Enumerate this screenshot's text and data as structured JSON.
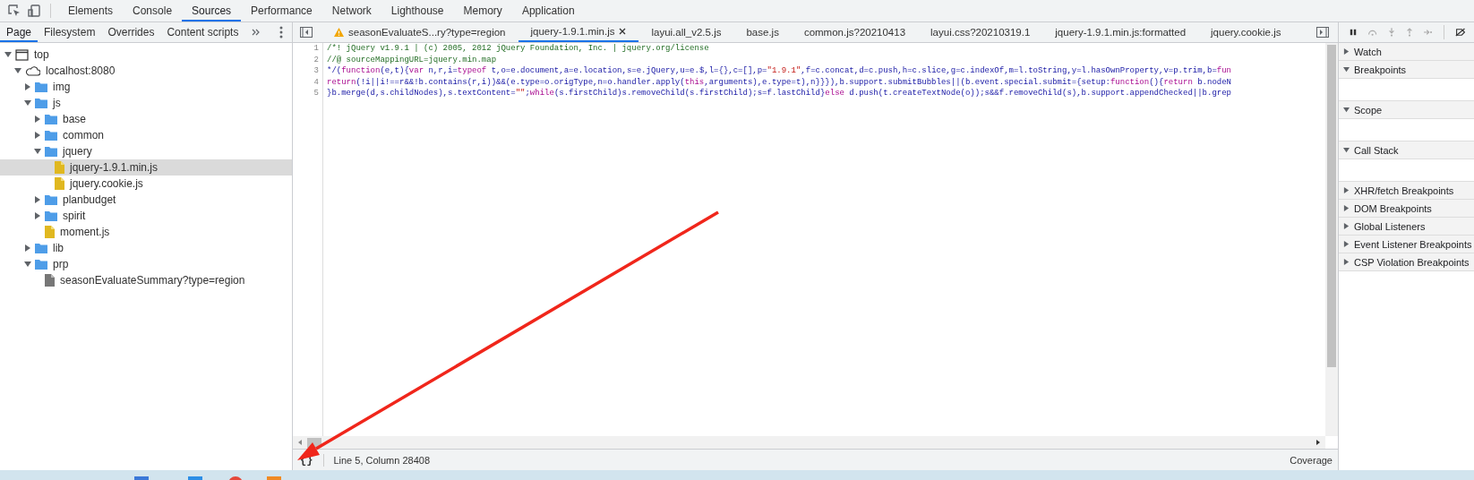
{
  "main_tabs": [
    {
      "label": "Elements",
      "selected": false
    },
    {
      "label": "Console",
      "selected": false
    },
    {
      "label": "Sources",
      "selected": true
    },
    {
      "label": "Performance",
      "selected": false
    },
    {
      "label": "Network",
      "selected": false
    },
    {
      "label": "Lighthouse",
      "selected": false
    },
    {
      "label": "Memory",
      "selected": false
    },
    {
      "label": "Application",
      "selected": false
    }
  ],
  "navigator_tabs": [
    {
      "label": "Page",
      "selected": true
    },
    {
      "label": "Filesystem",
      "selected": false
    },
    {
      "label": "Overrides",
      "selected": false
    },
    {
      "label": "Content scripts",
      "selected": false
    }
  ],
  "file_tree": [
    {
      "label": "top",
      "kind": "frame",
      "expanded": true,
      "selected": false,
      "children": [
        {
          "label": "localhost:8080",
          "kind": "domain",
          "expanded": true,
          "selected": false,
          "children": [
            {
              "label": "img",
              "kind": "folder",
              "expanded": false,
              "selected": false
            },
            {
              "label": "js",
              "kind": "folder",
              "expanded": true,
              "selected": false,
              "children": [
                {
                  "label": "base",
                  "kind": "folder",
                  "expanded": false,
                  "selected": false
                },
                {
                  "label": "common",
                  "kind": "folder",
                  "expanded": false,
                  "selected": false
                },
                {
                  "label": "jquery",
                  "kind": "folder",
                  "expanded": true,
                  "selected": false,
                  "children": [
                    {
                      "label": "jquery-1.9.1.min.js",
                      "kind": "script",
                      "selected": true
                    },
                    {
                      "label": "jquery.cookie.js",
                      "kind": "script",
                      "selected": false
                    }
                  ]
                },
                {
                  "label": "planbudget",
                  "kind": "folder",
                  "expanded": false,
                  "selected": false
                },
                {
                  "label": "spirit",
                  "kind": "folder",
                  "expanded": false,
                  "selected": false
                },
                {
                  "label": "moment.js",
                  "kind": "script",
                  "selected": false
                }
              ]
            },
            {
              "label": "lib",
              "kind": "folder",
              "expanded": false,
              "selected": false
            },
            {
              "label": "prp",
              "kind": "folder",
              "expanded": true,
              "selected": false,
              "children": [
                {
                  "label": "seasonEvaluateSummary?type=region",
                  "kind": "document",
                  "selected": false
                }
              ]
            }
          ]
        }
      ]
    }
  ],
  "editor_tabs": [
    {
      "label": "seasonEvaluateS...ry?type=region",
      "warning": true,
      "selected": false
    },
    {
      "label": "jquery-1.9.1.min.js",
      "warning": false,
      "selected": true
    },
    {
      "label": "layui.all_v2.5.js",
      "warning": false,
      "selected": false
    },
    {
      "label": "base.js",
      "warning": false,
      "selected": false
    },
    {
      "label": "common.js?20210413",
      "warning": false,
      "selected": false
    },
    {
      "label": "layui.css?20210319.1",
      "warning": false,
      "selected": false
    },
    {
      "label": "jquery-1.9.1.min.js:formatted",
      "warning": false,
      "selected": false
    },
    {
      "label": "jquery.cookie.js",
      "warning": false,
      "selected": false
    }
  ],
  "code_lines": [
    {
      "number": "1",
      "segments": [
        {
          "kind": "comment",
          "text": "/*! jQuery v1.9.1 | (c) 2005, 2012 jQuery Foundation, Inc. | jquery.org/license"
        }
      ]
    },
    {
      "number": "2",
      "segments": [
        {
          "kind": "comment",
          "text": "//@ sourceMappingURL=jquery.min.map"
        }
      ]
    },
    {
      "number": "3",
      "segments": [
        {
          "kind": "plain",
          "text": "*/("
        },
        {
          "kind": "keyword",
          "text": "function"
        },
        {
          "kind": "plain",
          "text": "(e,t){"
        },
        {
          "kind": "keyword",
          "text": "var"
        },
        {
          "kind": "plain",
          "text": " n,r,i="
        },
        {
          "kind": "keyword",
          "text": "typeof"
        },
        {
          "kind": "plain",
          "text": " t,o=e.document,a=e.location,s=e.jQuery,u=e.$,l={},c=[],p="
        },
        {
          "kind": "string",
          "text": "\"1.9.1\""
        },
        {
          "kind": "plain",
          "text": ",f=c.concat,d=c.push,h=c.slice,g=c.indexOf,m=l.toString,y=l.hasOwnProperty,v=p.trim,b="
        },
        {
          "kind": "keyword",
          "text": "fun"
        }
      ]
    },
    {
      "number": "4",
      "segments": [
        {
          "kind": "keyword",
          "text": "return"
        },
        {
          "kind": "plain",
          "text": "(!i||i!==r&&!b.contains(r,i))&&(e.type=o.origType,n=o.handler.apply("
        },
        {
          "kind": "keyword",
          "text": "this"
        },
        {
          "kind": "plain",
          "text": ",arguments),e.type=t),n}}}),b.support.submitBubbles||(b.event.special.submit={setup:"
        },
        {
          "kind": "keyword",
          "text": "function"
        },
        {
          "kind": "plain",
          "text": "(){"
        },
        {
          "kind": "keyword",
          "text": "return"
        },
        {
          "kind": "plain",
          "text": " b.nodeN"
        }
      ]
    },
    {
      "number": "5",
      "segments": [
        {
          "kind": "plain",
          "text": "}b.merge(d,s.childNodes),s.textContent="
        },
        {
          "kind": "string",
          "text": "\"\""
        },
        {
          "kind": "plain",
          "text": ";"
        },
        {
          "kind": "keyword",
          "text": "while"
        },
        {
          "kind": "plain",
          "text": "(s.firstChild)s.removeChild(s.firstChild);s=f.lastChild}"
        },
        {
          "kind": "keyword",
          "text": "else"
        },
        {
          "kind": "plain",
          "text": " d.push(t.createTextNode(o));s&&f.removeChild(s),b.support.appendChecked||b.grep"
        }
      ]
    }
  ],
  "status_bar": {
    "format_button": "{}",
    "position": "Line 5, Column 28408",
    "coverage": "Coverage"
  },
  "debugger_sections": [
    {
      "label": "Watch",
      "expanded": false
    },
    {
      "label": "Breakpoints",
      "expanded": true
    },
    {
      "label": "Scope",
      "expanded": true
    },
    {
      "label": "Call Stack",
      "expanded": true
    },
    {
      "label": "XHR/fetch Breakpoints",
      "expanded": false
    },
    {
      "label": "DOM Breakpoints",
      "expanded": false
    },
    {
      "label": "Global Listeners",
      "expanded": false
    },
    {
      "label": "Event Listener Breakpoints",
      "expanded": false
    },
    {
      "label": "CSP Violation Breakpoints",
      "expanded": false
    }
  ]
}
